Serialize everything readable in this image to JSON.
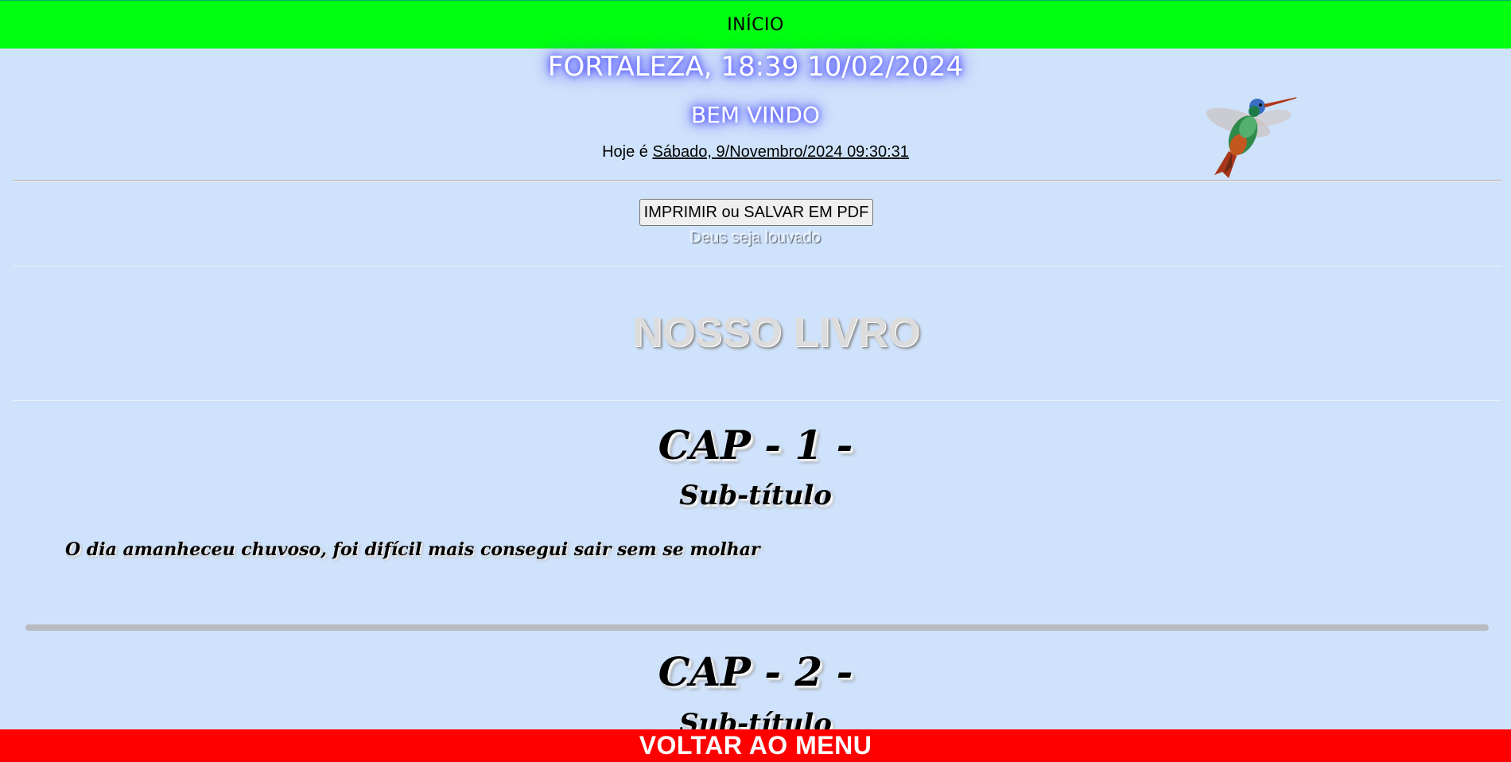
{
  "nav": {
    "home_label": "INÍCIO",
    "back_label": "VOLTAR AO MENU"
  },
  "header": {
    "city_time": "FORTALEZA, 18:39 10/02/2024",
    "welcome": "BEM VINDO",
    "today_prefix": "Hoje é",
    "today_date": "Sábado, 9/Novembro/2024 09:30:31"
  },
  "actions": {
    "print_label": "IMPRIMIR ou SALVAR EM PDF",
    "praise": "Deus seja louvado"
  },
  "book": {
    "title": "NOSSO LIVRO",
    "chapters": [
      {
        "title": "CAP - 1 -",
        "subtitle": "Sub-título",
        "text": "O dia amanheceu chuvoso, foi difícil mais consegui sair sem se molhar"
      },
      {
        "title": "CAP - 2 -",
        "subtitle": "Sub-título"
      }
    ]
  },
  "colors": {
    "page_background": "#cfe2fb",
    "top_bar": "#00ff10",
    "bottom_bar": "#ff0000"
  },
  "icons": {
    "decoration": "hummingbird-image"
  }
}
